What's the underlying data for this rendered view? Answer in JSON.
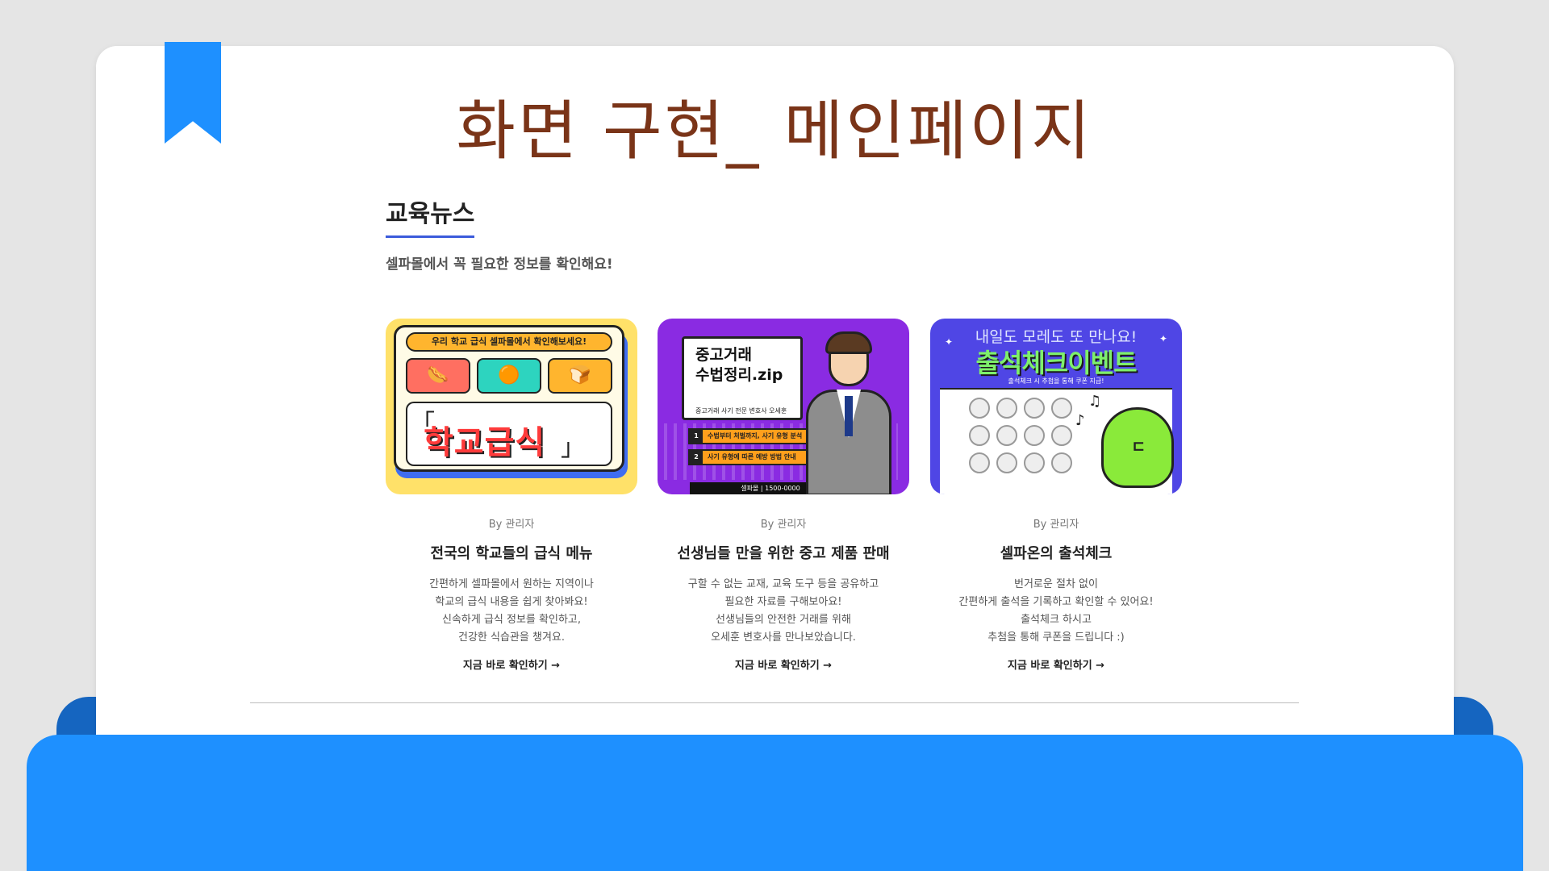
{
  "slide": {
    "title": "화면 구현_ 메인페이지"
  },
  "section": {
    "title": "교육뉴스",
    "subtitle": "셀파몰에서 꼭 필요한 정보를 확인해요!"
  },
  "cards": [
    {
      "author": "By 관리자",
      "title": "전국의 학교들의 급식 메뉴",
      "desc": [
        "간편하게 셀파몰에서 원하는 지역이나",
        "학교의 급식 내용을 쉽게 찾아봐요!",
        "신속하게 급식 정보를 확인하고,",
        "건강한 식습관을 챙겨요."
      ],
      "link": "지금 바로 확인하기 →",
      "image": {
        "banner": "우리 학교 급식 셀파몰에서 확인해보세요!",
        "word": "학교급식"
      }
    },
    {
      "author": "By 관리자",
      "title": "선생님들 만을 위한 중고 제품 판매",
      "desc": [
        "구할 수 없는 교재, 교육 도구 등을 공유하고",
        "필요한 자료를 구해보아요!",
        "선생님들의 안전한 거래를 위해",
        "오세훈 변호사를 만나보았습니다."
      ],
      "link": "지금 바로 확인하기 →",
      "image": {
        "title_line1": "중고거래",
        "title_line2": "수법정리.zip",
        "small": "중고거래 사기 전문 변호사 오세훈",
        "item1": "수법부터 처벌까지, 사기 유형 분석",
        "item2": "사기 유형에 따른 예방 방법 안내",
        "footer": "셀파몰 | 1500-0000"
      }
    },
    {
      "author": "By 관리자",
      "title": "셀파온의 출석체크",
      "desc": [
        "번거로운 절차 없이",
        "간편하게 출석을 기록하고 확인할 수 있어요!",
        "출석체크 하시고",
        "추첨을 통해 쿠폰을 드립니다 :)"
      ],
      "link": "지금 바로 확인하기 →",
      "image": {
        "top": "내일도 모레도 또 만나요!",
        "main": "출석체크이벤트",
        "sub": "출석체크 시 추첨을 통해 쿠폰 지급!"
      }
    }
  ],
  "colors": {
    "title": "#7a3418",
    "accent": "#1e90ff",
    "accent_dark": "#1565c0",
    "underline": "#3b5bdb"
  },
  "icons": [
    "bookmark-icon",
    "arrow-right-icon"
  ]
}
